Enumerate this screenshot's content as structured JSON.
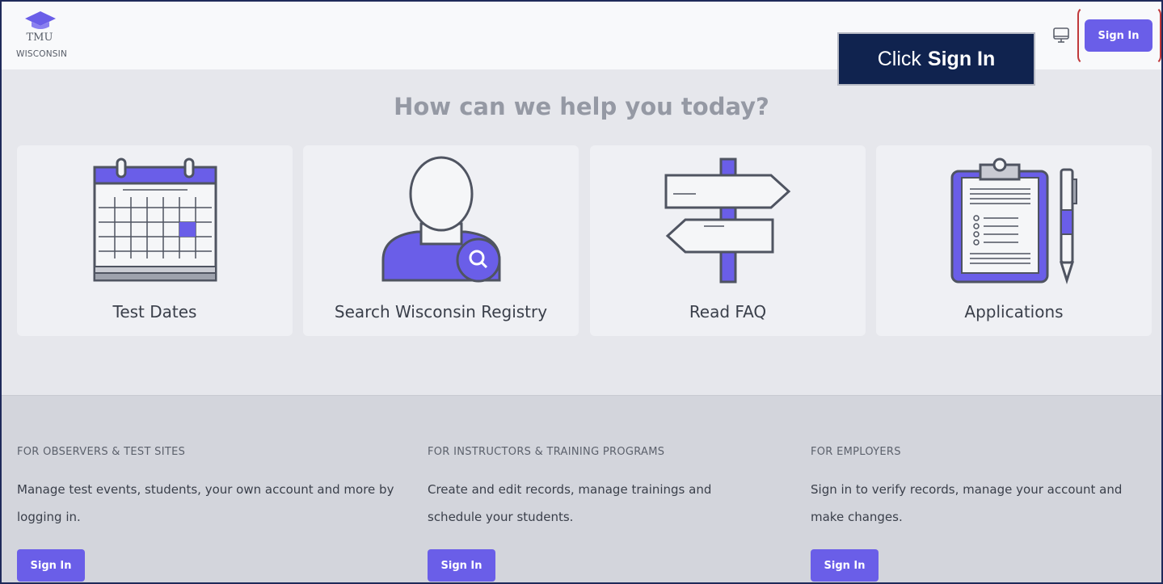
{
  "header": {
    "logo_line1": "TMU",
    "logo_line2": "WISCONSIN",
    "signin_label": "Sign In",
    "monitor_icon": "monitor-icon"
  },
  "callout": {
    "prefix": "Click",
    "emphasis": "Sign In"
  },
  "headline": "How can we help you today?",
  "cards": [
    {
      "label": "Test Dates",
      "icon": "calendar-icon"
    },
    {
      "label": "Search Wisconsin Registry",
      "icon": "person-search-icon"
    },
    {
      "label": "Read FAQ",
      "icon": "signpost-icon"
    },
    {
      "label": "Applications",
      "icon": "clipboard-icon"
    }
  ],
  "footer": {
    "columns": [
      {
        "heading": "FOR OBSERVERS & TEST SITES",
        "text": "Manage test events, students, your own account and more by logging in.",
        "button": "Sign In"
      },
      {
        "heading": "FOR INSTRUCTORS & TRAINING PROGRAMS",
        "text": "Create and edit records, manage trainings and schedule your students.",
        "button": "Sign In"
      },
      {
        "heading": "FOR EMPLOYERS",
        "text": "Sign in to verify records, manage your account and make changes.",
        "button": "Sign In"
      }
    ]
  },
  "colors": {
    "accent": "#6a5ee8",
    "callout_bg": "#10234f",
    "highlight": "#c0393b"
  }
}
